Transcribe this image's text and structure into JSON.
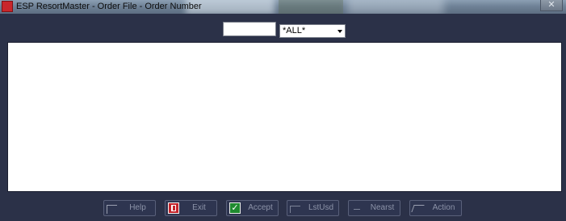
{
  "window": {
    "title": "ESP ResortMaster - Order File - Order Number",
    "close_glyph": "✕"
  },
  "search": {
    "order_number_value": "",
    "filter_selected": "*ALL*"
  },
  "toolbar": {
    "help_label": "Help",
    "exit_label": "Exit",
    "accept_label": "Accept",
    "lstusd_label": "LstUsd",
    "nearst_label": "Nearst",
    "action_label": "Action",
    "accept_icon_glyph": "✓"
  },
  "colors": {
    "background": "#2b3148",
    "list_background": "#ffffff",
    "exit_icon": "#c4242b",
    "accept_icon": "#1f8a2f"
  }
}
